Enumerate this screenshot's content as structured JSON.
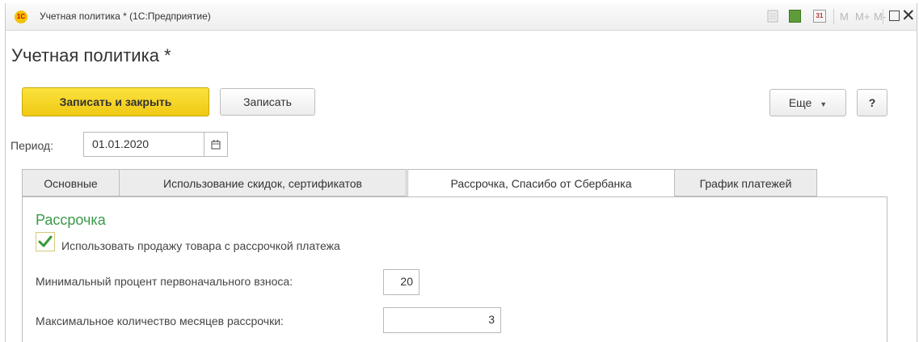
{
  "window": {
    "title": "Учетная политика * (1С:Предприятие)",
    "logo_text": "1С",
    "calendar_day": "31",
    "memory_buttons": [
      "M",
      "M+",
      "M-"
    ]
  },
  "form": {
    "title": "Учетная политика *",
    "buttons": {
      "save_close": "Записать и закрыть",
      "save": "Записать",
      "more": "Еще",
      "help": "?"
    },
    "period": {
      "label": "Период:",
      "value": "01.01.2020"
    },
    "tabs": [
      {
        "label": "Основные",
        "active": false
      },
      {
        "label": "Использование скидок, сертификатов",
        "active": false
      },
      {
        "label": "Рассрочка, Спасибо от Сбербанка",
        "active": true
      },
      {
        "label": "График платежей",
        "active": false
      }
    ],
    "installment": {
      "section_title": "Рассрочка",
      "use_checkbox_label": "Использовать продажу товара с рассрочкой платежа",
      "use_checked": true,
      "min_percent_label": "Минимальный процент первоначального взноса:",
      "min_percent_value": "20",
      "max_months_label": "Максимальное количество месяцев рассрочки:",
      "max_months_value": "3"
    }
  },
  "colors": {
    "accent_button": "#f5d428",
    "section_title": "#3b9a4a",
    "check_mark": "#3a9a3a"
  }
}
